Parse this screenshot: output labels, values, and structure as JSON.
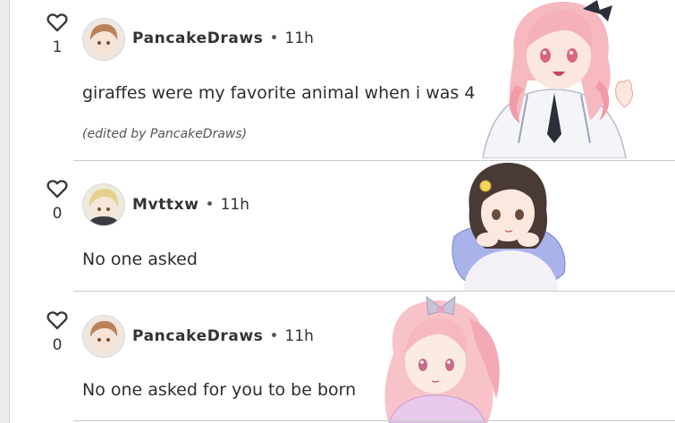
{
  "comments": [
    {
      "likes": "1",
      "username": "PancakeDraws",
      "separator": "•",
      "time": "11h",
      "text": "giraffes were my favorite animal when i was 4",
      "edited_note": "(edited by PancakeDraws)",
      "avatar": "avatar-brown-hair-character",
      "sticker": "pink-hair-girl-waving-sticker"
    },
    {
      "likes": "0",
      "username": "Mvttxw",
      "separator": "•",
      "time": "11h",
      "text": "No one asked",
      "avatar": "avatar-blonde-character",
      "sticker": "dark-hair-girl-hugging-pillow-sticker"
    },
    {
      "likes": "0",
      "username": "PancakeDraws",
      "separator": "•",
      "time": "11h",
      "text": "No one asked for you to be born",
      "avatar": "avatar-brown-hair-character",
      "sticker": "pink-hair-girl-ribbon-sticker"
    }
  ],
  "icons": {
    "like": "heart-outline-icon"
  },
  "colors": {
    "separator": "#c8c8c8",
    "text": "#2e2e2e"
  }
}
